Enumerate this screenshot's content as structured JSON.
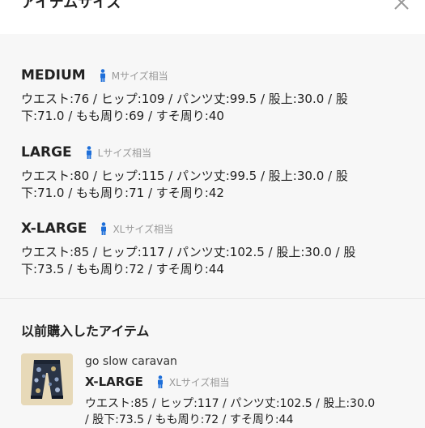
{
  "header": {
    "title": "アイテムサイズ"
  },
  "sizes": [
    {
      "name": "MEDIUM",
      "equivalent": "Mサイズ相当",
      "measurements": "ウエスト:76 / ヒップ:109 / パンツ丈:99.5 / 股上:30.0 / 股下:71.0 / もも周り:69 / すそ周り:40"
    },
    {
      "name": "LARGE",
      "equivalent": "Lサイズ相当",
      "measurements": "ウエスト:80 / ヒップ:115 / パンツ丈:99.5 / 股上:30.0 / 股下:71.0 / もも周り:71 / すそ周り:42"
    },
    {
      "name": "X-LARGE",
      "equivalent": "XLサイズ相当",
      "measurements": "ウエスト:85 / ヒップ:117 / パンツ丈:102.5 / 股上:30.0 / 股下:73.5 / もも周り:72 / すそ周り:44"
    }
  ],
  "previous": {
    "title": "以前購入したアイテム",
    "item": {
      "brand": "go slow caravan",
      "size": "X-LARGE",
      "equivalent": "XLサイズ相当",
      "measurements": "ウエスト:85 / ヒップ:117 / パンツ丈:102.5 / 股上:30.0 / 股下:73.5 / もも周り:72 / すそ周り:44"
    }
  },
  "colors": {
    "icon_blue": "#1e6fd9",
    "muted_text": "#999999",
    "background": "#f7f7f7",
    "header_bg": "#ffffff"
  },
  "icons": {
    "close": "close-icon",
    "person": "person-icon"
  }
}
